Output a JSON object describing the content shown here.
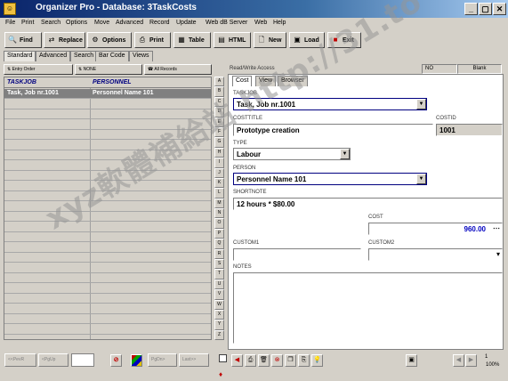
{
  "window": {
    "title": "Organizer Pro - Database: 3TaskCosts",
    "buttons": [
      "_",
      "▢",
      "✕"
    ]
  },
  "menu": [
    "File",
    "Print",
    "Search",
    "Options",
    "Move",
    "Advanced",
    "Record",
    "Update",
    "Web dB Server",
    "Web",
    "Help"
  ],
  "toolbar": {
    "find": "Find",
    "replace": "Replace",
    "options": "Options",
    "print": "Print",
    "table": "Table",
    "html": "HTML",
    "new": "New",
    "load": "Load",
    "exit": "Exit"
  },
  "search_tabs": [
    "Standard",
    "Advanced",
    "Search",
    "Bar Code",
    "Views"
  ],
  "sort_buttons": [
    "Entry Order",
    "NONE",
    "All Records"
  ],
  "grid": {
    "headers": [
      "TASKJOB",
      "PERSONNEL"
    ],
    "rows": [
      {
        "taskjob": "Task, Job nr.1001",
        "personnel": "Personnel Name 101"
      }
    ]
  },
  "alphabet": [
    "A",
    "B",
    "C",
    "D",
    "E",
    "F",
    "G",
    "H",
    "I",
    "J",
    "K",
    "L",
    "M",
    "N",
    "O",
    "P",
    "Q",
    "R",
    "S",
    "T",
    "U",
    "V",
    "W",
    "X",
    "Y",
    "Z"
  ],
  "nav_buttons": [
    "<<PevR",
    "<PgUp",
    "PgDn>",
    "Last>>"
  ],
  "form": {
    "access": "Read/Write Access",
    "field_1": "NO",
    "field_2": "Blank",
    "tabs": [
      "Cost",
      "View",
      "Browser"
    ],
    "taskjob_label": "TASKJOB",
    "taskjob_value": "Task, Job nr.1001",
    "costtitle_label": "COSTTITLE",
    "costtitle_value": "Prototype creation",
    "costid_label": "COSTID",
    "costid_value": "1001",
    "type_label": "TYPE",
    "type_value": "Labour",
    "person_label": "PERSON",
    "person_value": "Personnel Name 101",
    "shortnote_label": "SHORTNOTE",
    "shortnote_value": "12 hours * $80.00",
    "cost_label": "COST",
    "cost_value": "960.00",
    "custom1_label": "CUSTOM1",
    "custom2_label": "CUSTOM2",
    "notes_label": "NOTES"
  },
  "status": {
    "left": "1",
    "right": "100%"
  },
  "watermark": "xyz軟體補給站 http://31.to"
}
